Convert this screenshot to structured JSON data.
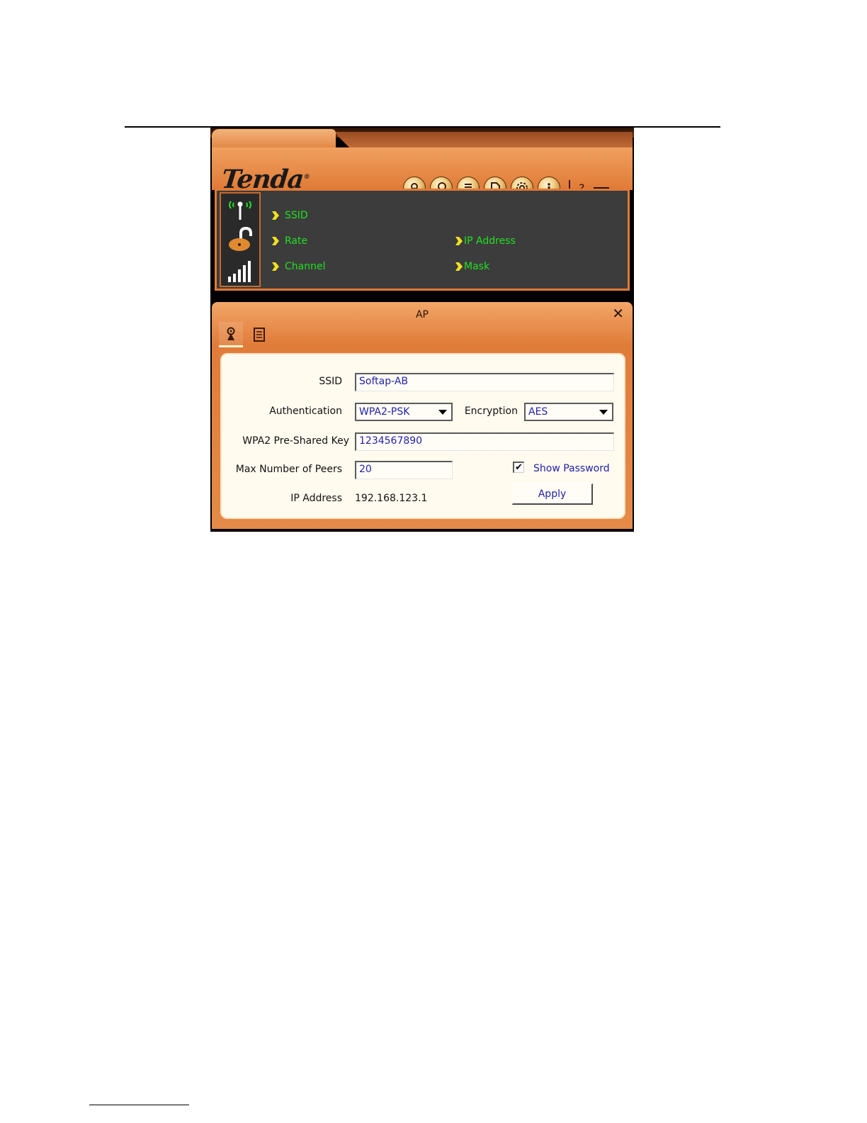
{
  "brand": {
    "logo_text": "Tenda"
  },
  "toolbar": {
    "buttons": [
      {
        "icon": "antenna-icon"
      },
      {
        "icon": "search-icon"
      },
      {
        "icon": "list-icon"
      },
      {
        "icon": "document-icon"
      },
      {
        "icon": "gear-icon"
      },
      {
        "icon": "info-icon"
      }
    ],
    "help_label": "?"
  },
  "status": {
    "ssid_label": "SSID",
    "rate_label": "Rate",
    "channel_label": "Channel",
    "ip_label": "IP Address",
    "mask_label": "Mask",
    "text_color": "#22e022"
  },
  "ap_dialog": {
    "title": "AP",
    "close_glyph": "✕",
    "form": {
      "ssid_label": "SSID",
      "ssid_value": "Softap-AB",
      "auth_label": "Authentication",
      "auth_value": "WPA2-PSK",
      "enc_label": "Encryption",
      "enc_value": "AES",
      "psk_label": "WPA2 Pre-Shared Key",
      "psk_value": "1234567890",
      "peers_label": "Max Number of Peers",
      "peers_value": "20",
      "show_password_label": "Show Password",
      "show_password_checked": true,
      "check_glyph": "✔",
      "ip_label": "IP Address",
      "ip_value": "192.168.123.1",
      "apply_label": "Apply"
    }
  },
  "colors": {
    "accent_orange": "#e07a36",
    "panel_dark": "#3c3c3c",
    "form_bg": "#fffbef",
    "value_blue": "#2222aa"
  }
}
